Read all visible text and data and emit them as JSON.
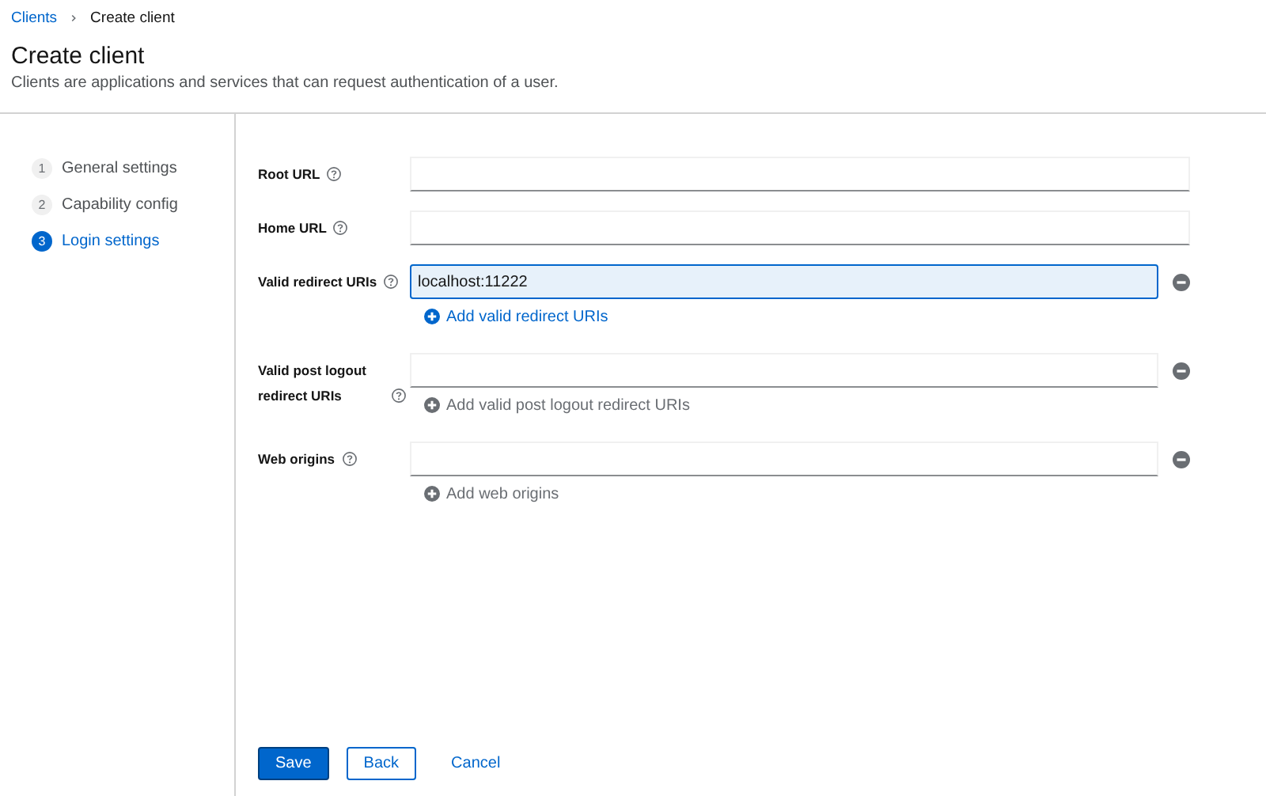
{
  "breadcrumb": [
    {
      "label": "Clients",
      "kind": "link"
    },
    {
      "label": "Create client",
      "kind": "current"
    }
  ],
  "page": {
    "title": "Create client",
    "description": "Clients are applications and services that can request authentication of a user."
  },
  "steps": [
    {
      "number": "1",
      "label": "General settings",
      "selected": false
    },
    {
      "number": "2",
      "label": "Capability config",
      "selected": false
    },
    {
      "number": "3",
      "label": "Login settings",
      "selected": true
    }
  ],
  "fields": [
    {
      "kind": "single",
      "label": "Root URL",
      "focused": false
    },
    {
      "kind": "single",
      "label": "Home URL",
      "focused": false
    },
    {
      "kind": "multi",
      "label": "Valid redirect URIs",
      "value": "localhost:11222",
      "focused": true,
      "add_label": "Add valid redirect URIs",
      "add_disabled": false
    },
    {
      "kind": "multi",
      "label": "Valid post logout redirect URIs",
      "focused": false,
      "add_label": "Add valid post logout redirect URIs",
      "add_disabled": true
    },
    {
      "kind": "multi",
      "label": "Web origins",
      "focused": false,
      "add_label": "Add web origins",
      "add_disabled": true
    }
  ],
  "buttons": [
    {
      "label": "Save",
      "kind": "primary"
    },
    {
      "label": "Back",
      "kind": "secondary"
    },
    {
      "label": "Cancel",
      "kind": "link"
    }
  ]
}
